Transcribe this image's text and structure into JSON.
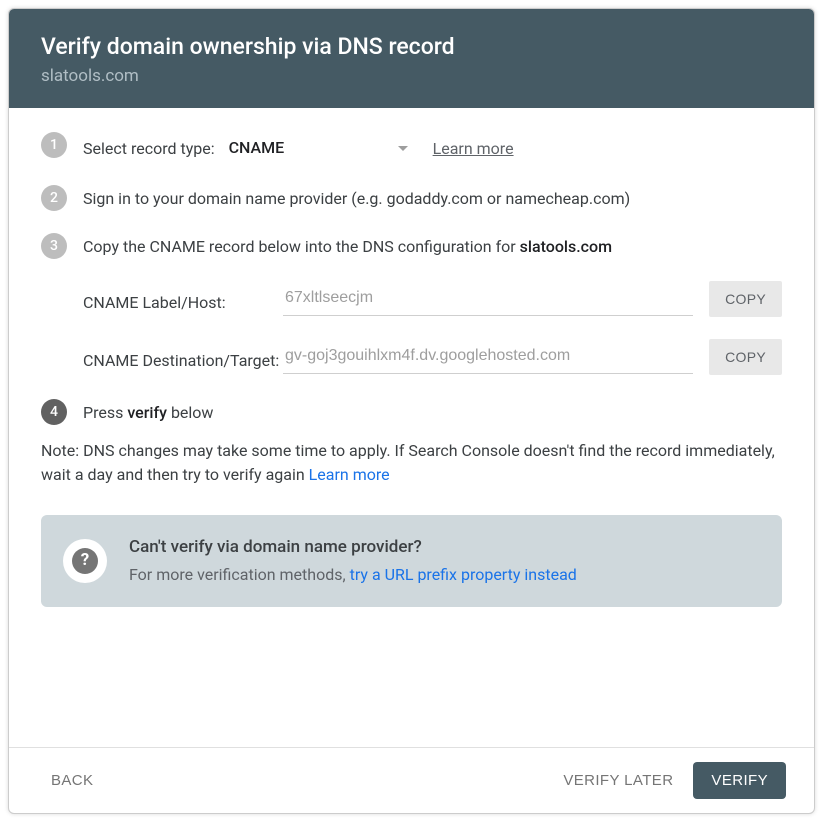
{
  "header": {
    "title": "Verify domain ownership via DNS record",
    "subtitle": "slatools.com"
  },
  "steps": {
    "s1": {
      "num": "1",
      "label": "Select record type:",
      "selectValue": "CNAME",
      "learn": "Learn more"
    },
    "s2": {
      "num": "2",
      "text": "Sign in to your domain name provider (e.g. godaddy.com or namecheap.com)"
    },
    "s3": {
      "num": "3",
      "prefix": "Copy the CNAME record below into the DNS configuration for ",
      "domain": "slatools.com"
    },
    "s4": {
      "num": "4",
      "prefix": "Press ",
      "bold": "verify",
      "suffix": " below"
    }
  },
  "fields": {
    "labelHost": {
      "label": "CNAME Label/Host:",
      "value": "67xltlseecjm",
      "copy": "COPY"
    },
    "destTarget": {
      "label": "CNAME Destination/Target:",
      "value": "gv-goj3gouihlxm4f.dv.googlehosted.com",
      "copy": "COPY"
    }
  },
  "note": {
    "text": "Note: DNS changes may take some time to apply. If Search Console doesn't find the record immediately, wait a day and then try to verify again ",
    "link": "Learn more"
  },
  "infoBox": {
    "title": "Can't verify via domain name provider?",
    "textPrefix": "For more verification methods, ",
    "link": "try a URL prefix property instead"
  },
  "footer": {
    "back": "BACK",
    "later": "VERIFY LATER",
    "verify": "VERIFY"
  }
}
